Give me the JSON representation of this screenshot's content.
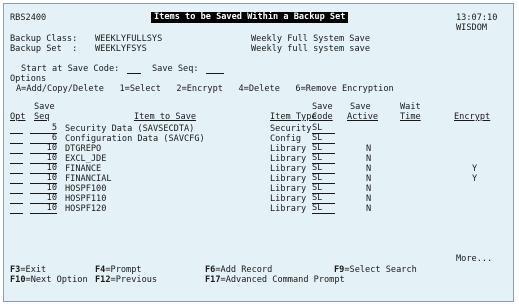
{
  "header": {
    "program": "RBS2400",
    "title": "Items to be Saved Within a Backup Set",
    "time": "13:07:10",
    "system": "WISDOM"
  },
  "backup": {
    "class_label": "Backup Class:",
    "class_value": "WEEKLYFULLSYS",
    "class_desc": "Weekly Full System Save",
    "set_label": "Backup Set  :",
    "set_value": "WEEKLYFSYS",
    "set_desc": "Weekly full system save"
  },
  "start": {
    "code_label": "Start at Save Code:",
    "code_value": "",
    "seq_label": "Save Seq:",
    "seq_value": ""
  },
  "options": {
    "heading": "Options",
    "line": "A=Add/Copy/Delete   1=Select   2=Encrypt   4=Delete   6=Remove Encryption"
  },
  "columns": {
    "opt": "Opt",
    "seq_top": "Save",
    "seq": "Seq",
    "item": "Item to Save",
    "type": "Item Type",
    "code_top": "Save",
    "code": "Code",
    "active_top": "Save",
    "active": "Active",
    "wait_top": "Wait",
    "wait": "Time",
    "encrypt": "Encrypt"
  },
  "rows": [
    {
      "seq": "5",
      "item": "Security Data (SAVSECDTA)",
      "type": "Security",
      "code": "SL",
      "active": "",
      "encrypt": ""
    },
    {
      "seq": "6",
      "item": "Configuration Data (SAVCFG)",
      "type": "Config",
      "code": "SL",
      "active": "",
      "encrypt": ""
    },
    {
      "seq": "10",
      "item": "DTGREPO",
      "type": "Library",
      "code": "SL",
      "active": "N",
      "encrypt": ""
    },
    {
      "seq": "10",
      "item": "EXCL_JDE",
      "type": "Library",
      "code": "SL",
      "active": "N",
      "encrypt": ""
    },
    {
      "seq": "10",
      "item": "FINANCE",
      "type": "Library",
      "code": "SL",
      "active": "N",
      "encrypt": "Y"
    },
    {
      "seq": "10",
      "item": "FINANCIAL",
      "type": "Library",
      "code": "SL",
      "active": "N",
      "encrypt": "Y"
    },
    {
      "seq": "10",
      "item": "HOSPF100",
      "type": "Library",
      "code": "SL",
      "active": "N",
      "encrypt": ""
    },
    {
      "seq": "10",
      "item": "HOSPF110",
      "type": "Library",
      "code": "SL",
      "active": "N",
      "encrypt": ""
    },
    {
      "seq": "10",
      "item": "HOSPF120",
      "type": "Library",
      "code": "SL",
      "active": "N",
      "encrypt": ""
    }
  ],
  "more": "More...",
  "fkeys": [
    {
      "key": "F3",
      "label": "=Exit"
    },
    {
      "key": "F4",
      "label": "=Prompt"
    },
    {
      "key": "F6",
      "label": "=Add Record"
    },
    {
      "key": "F9",
      "label": "=Select Search"
    },
    {
      "key": "F10",
      "label": "=Next Option"
    },
    {
      "key": "F12",
      "label": "=Previous"
    },
    {
      "key": "F17",
      "label": "=Advanced Command Prompt"
    }
  ],
  "colors": {
    "screen_bg": "#e4f1f7",
    "title_bg": "#000000",
    "title_fg": "#ffffff",
    "text": "#1a1a1a"
  }
}
